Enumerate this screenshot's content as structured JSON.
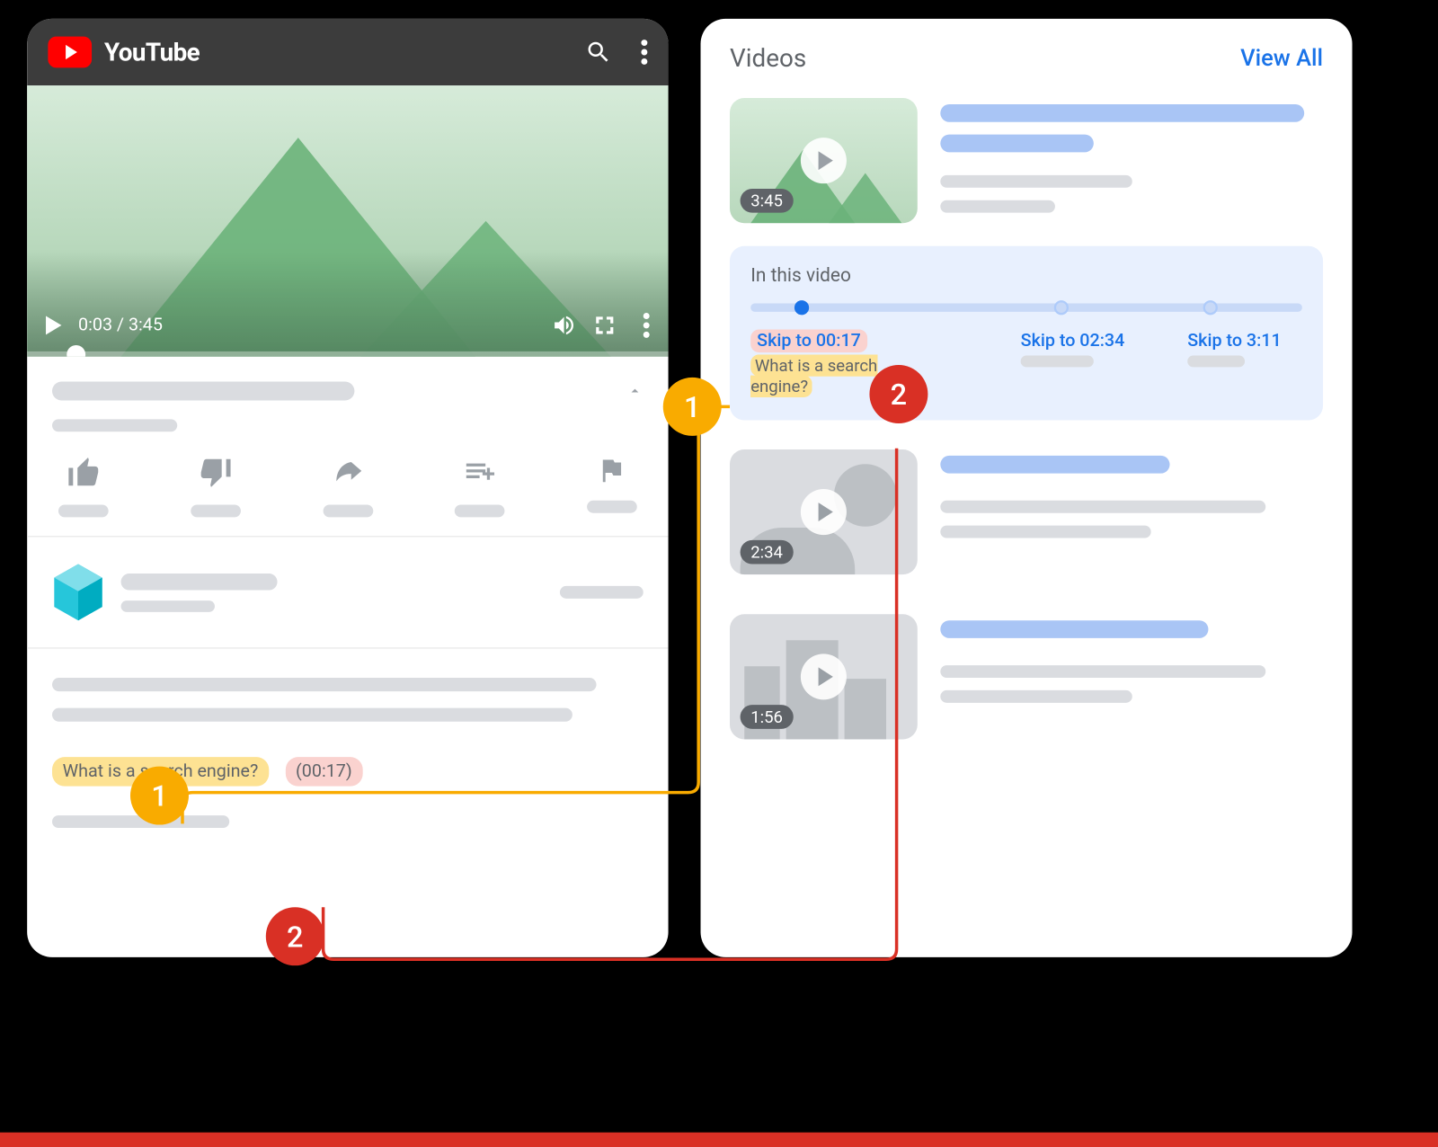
{
  "youtube": {
    "brand": "YouTube",
    "player": {
      "current_time": "0:03",
      "duration": "3:45",
      "separator": " / "
    },
    "description": {
      "chapter_title": "What is a search engine?",
      "timestamp": "(00:17)"
    }
  },
  "search_results": {
    "heading": "Videos",
    "view_all": "View All",
    "items": [
      {
        "duration": "3:45"
      },
      {
        "duration": "2:34"
      },
      {
        "duration": "1:56"
      }
    ],
    "key_moments": {
      "heading": "In this video",
      "moments": [
        {
          "skip_label": "Skip to 00:17",
          "title": "What is a search engine?"
        },
        {
          "skip_label": "Skip to 02:34"
        },
        {
          "skip_label": "Skip to 3:11"
        }
      ]
    }
  },
  "annotations": {
    "1": "1",
    "2": "2"
  }
}
